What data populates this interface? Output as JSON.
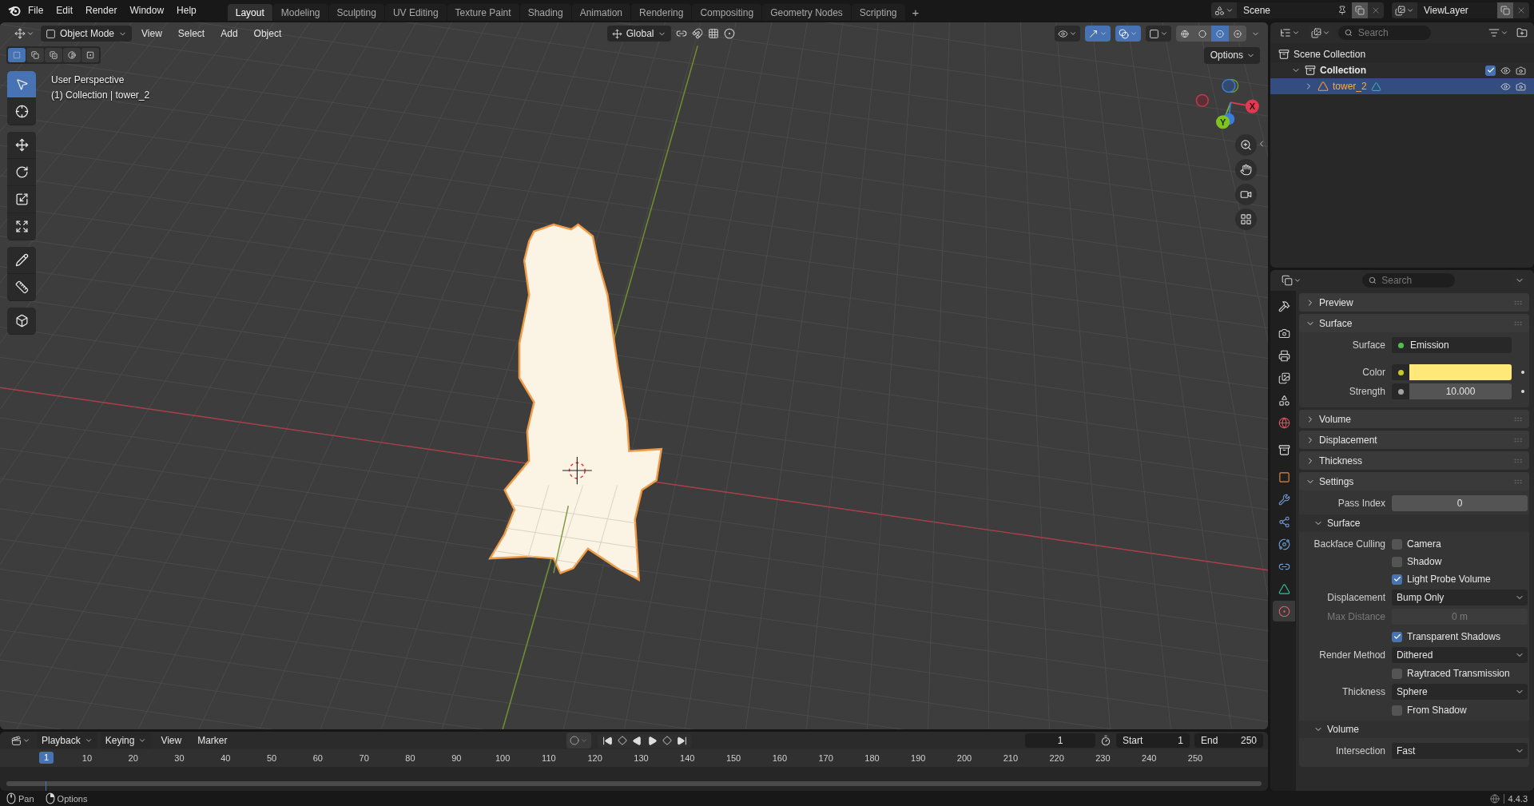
{
  "top_bar": {
    "menus": [
      "File",
      "Edit",
      "Render",
      "Window",
      "Help"
    ],
    "workspaces": [
      {
        "label": "Layout",
        "selected": true
      },
      {
        "label": "Modeling",
        "selected": false
      },
      {
        "label": "Sculpting",
        "selected": false
      },
      {
        "label": "UV Editing",
        "selected": false
      },
      {
        "label": "Texture Paint",
        "selected": false
      },
      {
        "label": "Shading",
        "selected": false
      },
      {
        "label": "Animation",
        "selected": false
      },
      {
        "label": "Rendering",
        "selected": false
      },
      {
        "label": "Compositing",
        "selected": false
      },
      {
        "label": "Geometry Nodes",
        "selected": false
      },
      {
        "label": "Scripting",
        "selected": false
      }
    ],
    "add_tab": "+",
    "scene": "Scene",
    "view_layer": "ViewLayer"
  },
  "viewport": {
    "header": {
      "mode": "Object Mode",
      "menus": [
        "View",
        "Select",
        "Add",
        "Object"
      ],
      "orientation": "Global",
      "toggles": [
        {
          "kind": "visibility",
          "on": false
        },
        {
          "kind": "gizmos",
          "on": true
        },
        {
          "kind": "overlays",
          "on": true
        },
        {
          "kind": "xray",
          "on": false
        }
      ],
      "shading": [
        {
          "kind": "wireframe",
          "selected": false
        },
        {
          "kind": "solid",
          "selected": false
        },
        {
          "kind": "material",
          "selected": true
        },
        {
          "kind": "rendered",
          "selected": false
        }
      ]
    },
    "select_modes": [
      {
        "kind": "new",
        "selected": true
      },
      {
        "kind": "extend",
        "selected": false
      },
      {
        "kind": "subtract",
        "selected": false
      },
      {
        "kind": "invert",
        "selected": false
      },
      {
        "kind": "intersect",
        "selected": false
      }
    ],
    "options": "Options",
    "info": [
      "User Perspective",
      "(1) Collection | tower_2"
    ],
    "tool_groups": [
      {
        "tools": [
          {
            "kind": "select",
            "selected": true
          },
          {
            "kind": "cursor",
            "selected": false
          }
        ]
      },
      {
        "tools": [
          {
            "kind": "move",
            "selected": false
          },
          {
            "kind": "rotate",
            "selected": false
          },
          {
            "kind": "scale",
            "selected": false
          },
          {
            "kind": "transform",
            "selected": false
          }
        ]
      },
      {
        "tools": [
          {
            "kind": "annotate",
            "selected": false
          },
          {
            "kind": "measure",
            "selected": false
          }
        ]
      },
      {
        "tools": [
          {
            "kind": "add_cube",
            "selected": false
          }
        ]
      }
    ],
    "gizmo": {
      "x": "X",
      "y": "Y"
    }
  },
  "timeline": {
    "menus": [
      {
        "label": "Playback",
        "dropdown": true
      },
      {
        "label": "Keying",
        "dropdown": true
      },
      {
        "label": "View",
        "dropdown": false
      },
      {
        "label": "Marker",
        "dropdown": false
      }
    ],
    "auto_keying": false,
    "current_frame": "1",
    "start_label": "Start",
    "start": "1",
    "end_label": "End",
    "end": "250",
    "playhead": "1",
    "ruler": [
      "10",
      "20",
      "30",
      "40",
      "50",
      "60",
      "70",
      "80",
      "90",
      "100",
      "110",
      "120",
      "130",
      "140",
      "150",
      "160",
      "170",
      "180",
      "190",
      "200",
      "210",
      "220",
      "230",
      "240",
      "250"
    ]
  },
  "outliner": {
    "search": {
      "placeholder": "Search"
    },
    "tree": [
      {
        "label": "Scene Collection",
        "kind": "scene_collection",
        "selected": false,
        "children": [
          {
            "label": "Collection",
            "kind": "collection",
            "selected": false,
            "expanded": true,
            "checked": true,
            "children": [
              {
                "label": "tower_2",
                "kind": "mesh",
                "selected": true,
                "expanded": false
              }
            ]
          }
        ]
      }
    ]
  },
  "properties": {
    "search": {
      "placeholder": "Search"
    },
    "tab_groups": [
      {
        "tabs": [
          {
            "kind": "tool",
            "selected": false
          }
        ]
      },
      {
        "tabs": [
          {
            "kind": "render",
            "selected": false
          },
          {
            "kind": "output",
            "selected": false
          },
          {
            "kind": "view_layer",
            "selected": false
          },
          {
            "kind": "scene",
            "selected": false
          },
          {
            "kind": "world",
            "selected": false
          }
        ]
      },
      {
        "tabs": [
          {
            "kind": "collection",
            "selected": false
          }
        ]
      },
      {
        "tabs": [
          {
            "kind": "object",
            "selected": false
          },
          {
            "kind": "modifiers",
            "selected": false
          },
          {
            "kind": "particles",
            "selected": false
          },
          {
            "kind": "physics",
            "selected": false
          },
          {
            "kind": "constraints",
            "selected": false
          },
          {
            "kind": "data",
            "selected": false
          },
          {
            "kind": "material",
            "selected": true
          }
        ]
      }
    ],
    "panels": [
      {
        "title": "Preview",
        "expanded": false
      },
      {
        "title": "Surface",
        "expanded": true,
        "rows": [
          {
            "kind": "shader",
            "label": "Surface",
            "value": "Emission"
          },
          {
            "kind": "color",
            "label": "Color",
            "color": "#ffe77a"
          },
          {
            "kind": "number",
            "label": "Strength",
            "value": "10.000"
          }
        ]
      },
      {
        "title": "Volume",
        "expanded": false
      },
      {
        "title": "Displacement",
        "expanded": false
      },
      {
        "title": "Thickness",
        "expanded": false
      },
      {
        "title": "Settings",
        "expanded": true,
        "rows": [
          {
            "kind": "field",
            "label": "Pass Index",
            "value": "0",
            "disabled": false
          },
          {
            "kind": "subpanel",
            "title": "Surface",
            "expanded": true,
            "rows": [
              {
                "kind": "checkbox",
                "label": "Backface Culling",
                "text": "Camera",
                "checked": false
              },
              {
                "kind": "checkbox",
                "text": "Shadow",
                "checked": false
              },
              {
                "kind": "checkbox",
                "text": "Light Probe Volume",
                "checked": true
              },
              {
                "kind": "dropdown",
                "label": "Displacement",
                "value": "Bump Only"
              },
              {
                "kind": "field",
                "label": "Max Distance",
                "value": "0 m",
                "disabled": true
              },
              {
                "kind": "checkbox",
                "text": "Transparent Shadows",
                "checked": true
              },
              {
                "kind": "dropdown",
                "label": "Render Method",
                "value": "Dithered"
              },
              {
                "kind": "checkbox",
                "text": "Raytraced Transmission",
                "checked": false
              },
              {
                "kind": "dropdown",
                "label": "Thickness",
                "value": "Sphere"
              },
              {
                "kind": "checkbox",
                "text": "From Shadow",
                "checked": false
              }
            ]
          },
          {
            "kind": "subpanel",
            "title": "Volume",
            "expanded": true,
            "rows": [
              {
                "kind": "dropdown",
                "label": "Intersection",
                "value": "Fast"
              }
            ]
          }
        ]
      }
    ]
  },
  "status_bar": {
    "hints": [
      {
        "kind": "mouse_middle",
        "label": "Pan"
      },
      {
        "kind": "mouse_right",
        "label": "Options"
      }
    ],
    "version": "4.4.3"
  }
}
